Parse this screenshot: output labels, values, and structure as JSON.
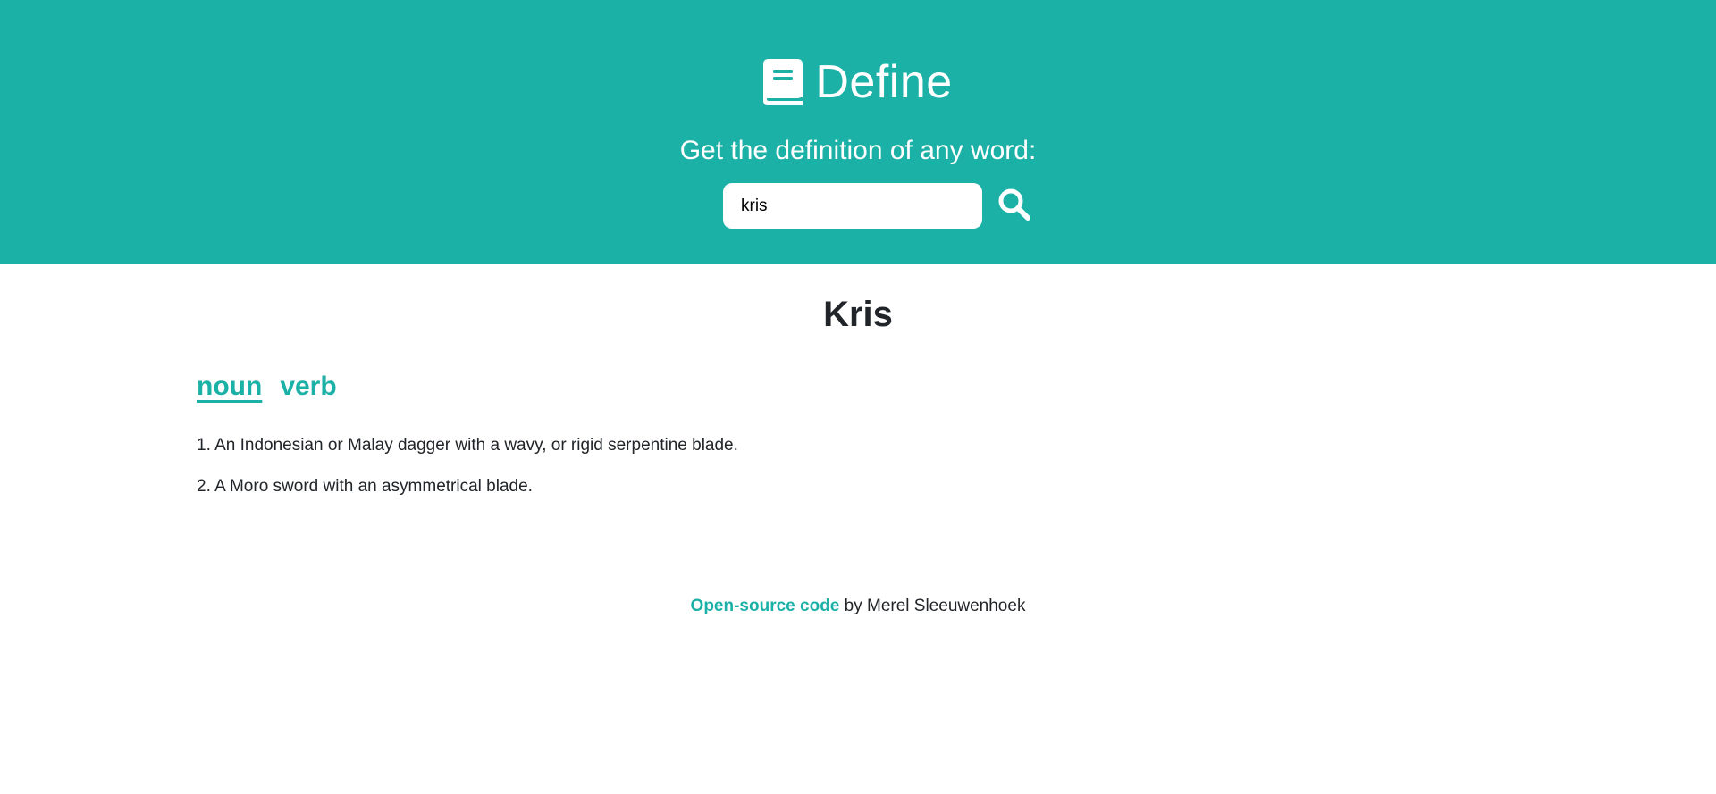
{
  "header": {
    "brand_title": "Define",
    "brand_icon": "book-icon",
    "subtitle": "Get the definition of any word:",
    "search": {
      "value": "kris",
      "placeholder": "",
      "button_icon": "search-icon"
    },
    "background_color": "#1bb1a7"
  },
  "result": {
    "word": "Kris",
    "tabs": [
      {
        "label": "noun",
        "active": true
      },
      {
        "label": "verb",
        "active": false
      }
    ],
    "definitions": [
      "1. An Indonesian or Malay dagger with a wavy, or rigid serpentine blade.",
      "2. A Moro sword with an asymmetrical blade."
    ]
  },
  "footer": {
    "link_text": "Open-source code",
    "suffix": " by Merel Sleeuwenhoek"
  },
  "colors": {
    "accent": "#1bb1a7",
    "text": "#212529"
  }
}
